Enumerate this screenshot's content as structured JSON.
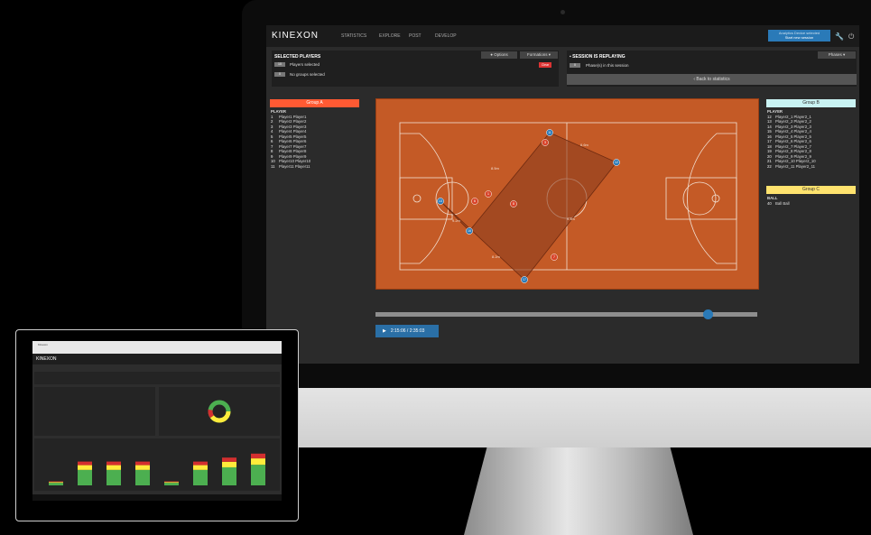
{
  "app": {
    "logo": "KINEXON",
    "nav": [
      "STATISTICS",
      "EXPLORE",
      "POST",
      "DEVELOP"
    ],
    "session_button": "Start new session",
    "session_button_sub": "Analytics Device selected"
  },
  "selected_players": {
    "title": "SELECTED PLAYERS",
    "players_count": "10",
    "players_text": "Players selected",
    "groups_count": "0",
    "groups_text": "No groups selected",
    "options_label": "Options",
    "formations_label": "Formations",
    "clear_label": "Clear"
  },
  "session": {
    "title": "SESSION IS REPLAYING",
    "phases_label": "Phases",
    "phase_count": "0",
    "phase_text": "Phase(s) in this session",
    "back_label": "Back to statistics"
  },
  "group_a": {
    "title": "Group A",
    "header": "PLAYER",
    "players": [
      {
        "num": "1",
        "name": "Player1 Player1"
      },
      {
        "num": "2",
        "name": "Player2 Player2"
      },
      {
        "num": "3",
        "name": "Player3 Player3"
      },
      {
        "num": "4",
        "name": "Player4 Player4"
      },
      {
        "num": "5",
        "name": "Player5 Player5"
      },
      {
        "num": "6",
        "name": "Player6 Player6"
      },
      {
        "num": "7",
        "name": "Player7 Player7"
      },
      {
        "num": "8",
        "name": "Player8 Player8"
      },
      {
        "num": "9",
        "name": "Player9 Player9"
      },
      {
        "num": "10",
        "name": "Player10 Player10"
      },
      {
        "num": "11",
        "name": "Player11 Player11"
      }
    ]
  },
  "group_b": {
    "title": "Group B",
    "header": "PLAYER",
    "players": [
      {
        "num": "12",
        "name": "Player2_1 Player2_1"
      },
      {
        "num": "13",
        "name": "Player2_2 Player2_2"
      },
      {
        "num": "14",
        "name": "Player2_3 Player2_3"
      },
      {
        "num": "15",
        "name": "Player2_4 Player2_4"
      },
      {
        "num": "16",
        "name": "Player2_5 Player2_5"
      },
      {
        "num": "17",
        "name": "Player2_6 Player2_6"
      },
      {
        "num": "18",
        "name": "Player2_7 Player2_7"
      },
      {
        "num": "19",
        "name": "Player2_8 Player2_8"
      },
      {
        "num": "20",
        "name": "Player2_9 Player2_9"
      },
      {
        "num": "21",
        "name": "Player2_10 Player2_10"
      },
      {
        "num": "22",
        "name": "Player2_11 Player2_11"
      }
    ]
  },
  "group_c": {
    "title": "Group C",
    "header": "BALL",
    "items": [
      {
        "num": "40",
        "name": "Ball Ball"
      }
    ]
  },
  "player_markers": {
    "red": [
      "3",
      "1",
      "8",
      "7",
      "6",
      "2"
    ],
    "blue": [
      "11",
      "12",
      "13",
      "16",
      "17",
      "19"
    ]
  },
  "distance_labels": [
    "6.6m",
    "8.5m",
    "9.2m",
    "8.2m",
    "9.4m"
  ],
  "timeline": {
    "time": "2:15:06 / 2:35:03",
    "progress": 0.87
  },
  "colors": {
    "accent": "#2a7ab8",
    "group_a": "#ff5a33",
    "group_b": "#c9f3f3",
    "group_c": "#ffe36e",
    "court": "#c45a26",
    "hull": "#8e3d1e"
  },
  "laptop": {
    "browser_tab": "Kinexon",
    "logo": "KINEXON",
    "bar_values": [
      0.1,
      0.6,
      0.6,
      0.6,
      0.1,
      0.6,
      0.7,
      0.8
    ]
  }
}
